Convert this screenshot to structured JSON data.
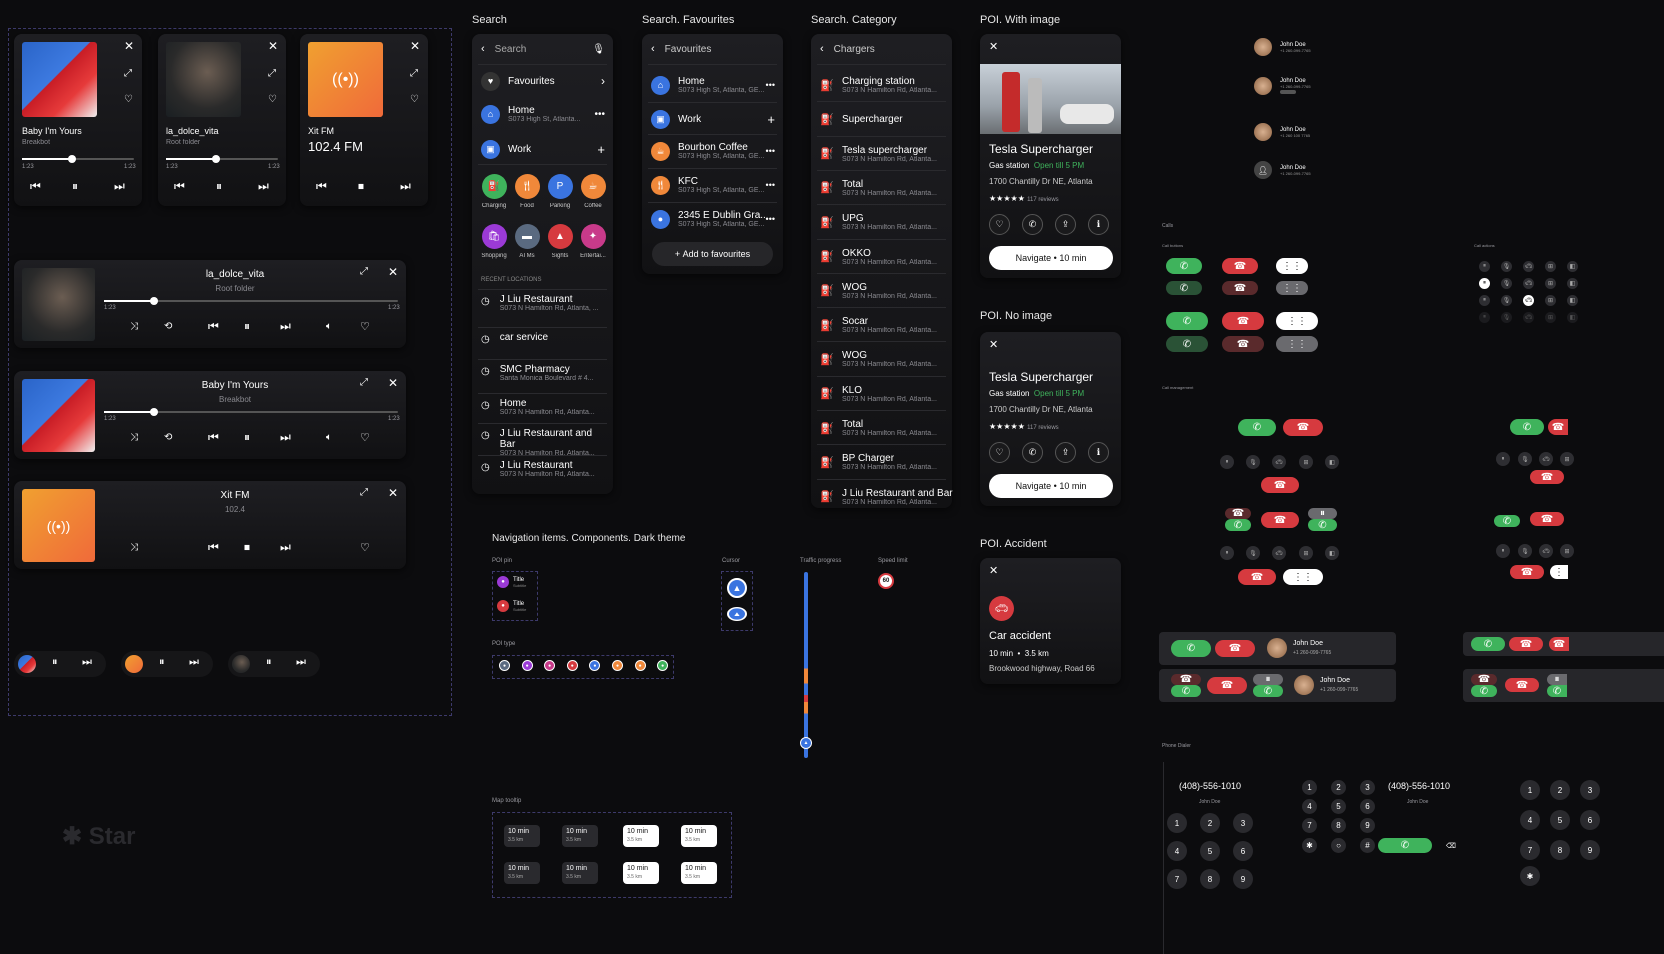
{
  "colors": {
    "bg": "#0c0c0e",
    "accent_blue": "#3a74e0",
    "green": "#3fb35c",
    "red": "#d63a3f",
    "orange": "#f0883a"
  },
  "players": {
    "small": [
      {
        "title": "Baby I'm Yours",
        "sub": "Breakbot",
        "t1": "1:23",
        "t2": "1:23",
        "progress": 0.45
      },
      {
        "title": "la_dolce_vita",
        "sub": "Root folder",
        "t1": "1:23",
        "t2": "1:23",
        "progress": 0.45
      },
      {
        "title": "Xit FM",
        "sub": "102.4 FM"
      }
    ],
    "wide": [
      {
        "title": "la_dolce_vita",
        "sub": "Root folder",
        "t1": "1:23",
        "t2": "1:23",
        "progress": 0.17
      },
      {
        "title": "Baby I'm Yours",
        "sub": "Breakbot",
        "t1": "1:23",
        "t2": "1:23",
        "progress": 0.17
      },
      {
        "title": "Xit FM",
        "sub": "102.4"
      }
    ]
  },
  "logo": "Star",
  "sections": {
    "search": "Search",
    "fav": "Search. Favourites",
    "cat": "Search. Category",
    "poi_img": "POI. With image",
    "poi_noimg": "POI. No image",
    "poi_acc": "POI. Accident",
    "nav": "Navigation items. Components. Dark theme",
    "calls": "Calls",
    "dialer": "Phone Dialer"
  },
  "search": {
    "placeholder": "Search",
    "favourites": "Favourites",
    "home": {
      "t": "Home",
      "s": "S073 High St, Atlanta..."
    },
    "work": "Work",
    "cats": [
      "Charging",
      "Food",
      "Parking",
      "Coffee",
      "Shopping",
      "ATMs",
      "Sights",
      "Entertai..."
    ],
    "recent_header": "RECENT LOCATIONS",
    "recent": [
      {
        "t": "J Liu Restaurant",
        "s": "S073 N Hamilton Rd, Atlanta, ..."
      },
      {
        "t": "car service",
        "s": ""
      },
      {
        "t": "SMC Pharmacy",
        "s": "Santa Monica Boulevard # 4..."
      },
      {
        "t": "Home",
        "s": "S073 N Hamilton Rd, Atlanta..."
      },
      {
        "t": "J Liu Restaurant and Bar",
        "s": "S073 N Hamilton Rd, Atlanta..."
      },
      {
        "t": "J Liu Restaurant",
        "s": "S073 N Hamilton Rd, Atlanta..."
      }
    ]
  },
  "favs": {
    "title": "Favourites",
    "items": [
      {
        "t": "Home",
        "s": "S073 High St, Atlanta, GE..."
      },
      {
        "t": "Work",
        "s": ""
      },
      {
        "t": "Bourbon Coffee",
        "s": "S073 High St, Atlanta, GE..."
      },
      {
        "t": "KFC",
        "s": "S073 High St, Atlanta, GE..."
      },
      {
        "t": "2345 E Dublin Gra...",
        "s": "S073 High St, Atlanta, GE..."
      }
    ],
    "add": "Add to favourites"
  },
  "chargers": {
    "title": "Chargers",
    "items": [
      {
        "t": "Charging station",
        "s": "S073 N Hamilton Rd, Atlanta..."
      },
      {
        "t": "Supercharger",
        "s": ""
      },
      {
        "t": "Tesla supercharger",
        "s": "S073 N Hamilton Rd, Atlanta..."
      },
      {
        "t": "Total",
        "s": "S073 N Hamilton Rd, Atlanta..."
      },
      {
        "t": "UPG",
        "s": "S073 N Hamilton Rd, Atlanta..."
      },
      {
        "t": "OKKO",
        "s": "S073 N Hamilton Rd, Atlanta..."
      },
      {
        "t": "WOG",
        "s": "S073 N Hamilton Rd, Atlanta..."
      },
      {
        "t": "Socar",
        "s": "S073 N Hamilton Rd, Atlanta..."
      },
      {
        "t": "WOG",
        "s": "S073 N Hamilton Rd, Atlanta..."
      },
      {
        "t": "KLO",
        "s": "S073 N Hamilton Rd, Atlanta..."
      },
      {
        "t": "Total",
        "s": "S073 N Hamilton Rd, Atlanta..."
      },
      {
        "t": "BP Charger",
        "s": "S073 N Hamilton Rd, Atlanta..."
      },
      {
        "t": "J Liu Restaurant and Bar",
        "s": "S073 N Hamilton Rd, Atlanta..."
      }
    ]
  },
  "poi": {
    "name": "Tesla Supercharger",
    "type": "Gas station",
    "open": "Open till 5 PM",
    "addr": "1700 Chantilly Dr NE, Atlanta",
    "stars": "★★★★★",
    "reviews": "117 reviews",
    "navigate": "Navigate • 10 min"
  },
  "accident": {
    "title": "Car accident",
    "time": "10 min",
    "dist": "3.5 km",
    "road": "Brookwood highway, Road 66"
  },
  "nav": {
    "poi_pin": "POI pin",
    "pin_title": "Title",
    "pin_sub": "Subtitle",
    "poi_type": "POI type",
    "cursor": "Cursor",
    "traffic": "Traffic progress",
    "speed": "Speed limit",
    "speed_val": "60",
    "tooltip": "Map tooltip",
    "tt_t": "10 min",
    "tt_s": "3.5 km"
  },
  "contacts": [
    {
      "name": "John Doe",
      "phone": "+1 260-099-7765"
    },
    {
      "name": "John Doe",
      "phone": "+1 260-099-7765"
    },
    {
      "name": "John Doe",
      "phone": "+1 260 100 7765"
    },
    {
      "name": "John Doe",
      "phone": "+1 260-099-7765"
    }
  ],
  "calls": {
    "buttons": "Call buttons",
    "actions": "Call actions",
    "mgmt": "Call management",
    "banner_name": "John Doe",
    "banner_phone": "+1 260-099-7765"
  },
  "dialer": {
    "number": "(408)-556-1010",
    "name": "John Doe",
    "keys": [
      "1",
      "2",
      "3",
      "4",
      "5",
      "6",
      "7",
      "8",
      "9"
    ]
  }
}
